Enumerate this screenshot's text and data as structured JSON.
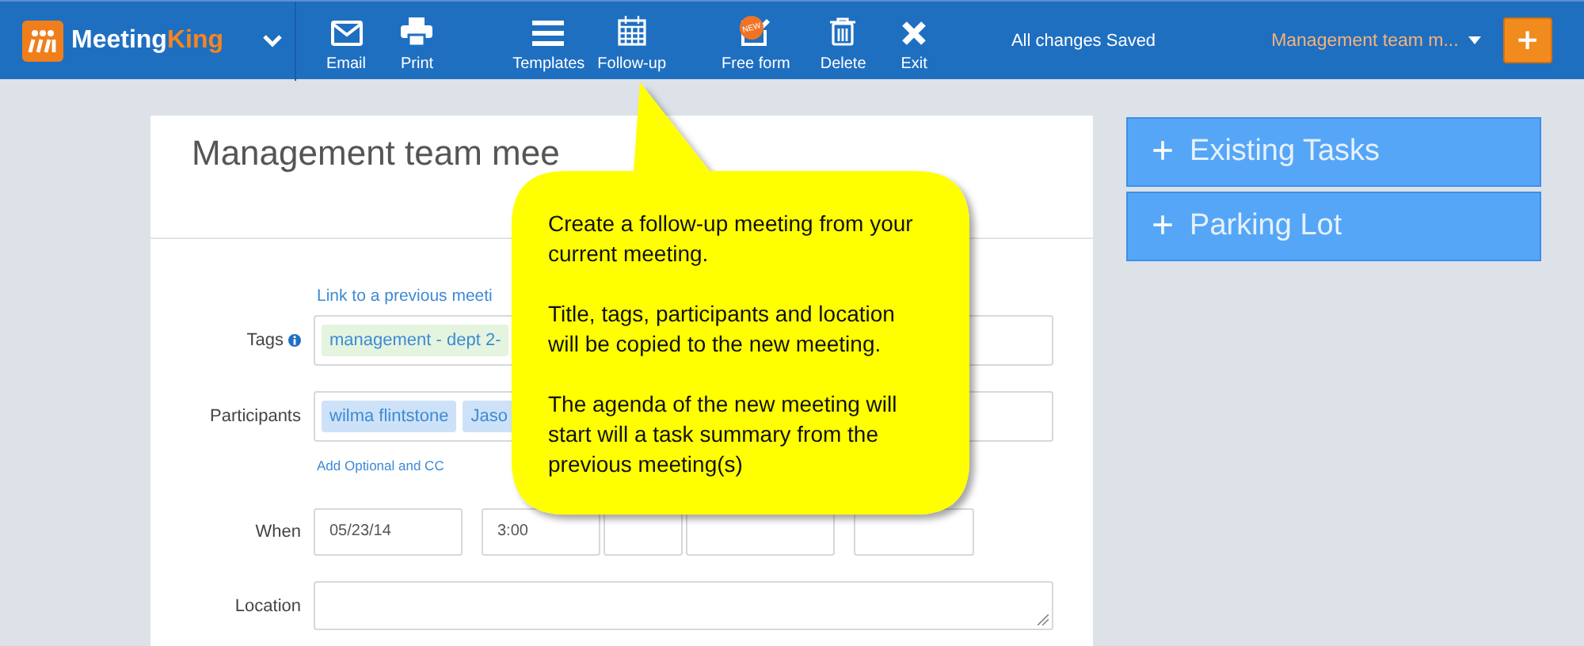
{
  "app": {
    "name_part1": "Meeting",
    "name_part2": "King"
  },
  "toolbar": [
    {
      "label": "Email"
    },
    {
      "label": "Print"
    },
    {
      "label": "Templates"
    },
    {
      "label": "Follow-up"
    },
    {
      "label": "Free form",
      "badge": "NEW"
    },
    {
      "label": "Delete"
    },
    {
      "label": "Exit"
    }
  ],
  "status": "All changes Saved",
  "meeting_select": "Management team m...",
  "add_button": "+",
  "form": {
    "title": "Management team mee",
    "link": "Link to a previous meeti",
    "tags": {
      "label": "Tags",
      "chips": [
        "management - dept 2-"
      ]
    },
    "participants": {
      "label": "Participants",
      "chips": [
        "wilma flintstone",
        "Jaso"
      ]
    },
    "add_link": "Add Optional and CC",
    "when": {
      "label": "When",
      "fields": [
        {
          "kind": "date",
          "value": "05/23/14"
        },
        {
          "kind": "time",
          "value": "3:00"
        },
        {
          "kind": "input"
        },
        {
          "kind": "input"
        },
        {
          "kind": "input"
        }
      ]
    },
    "location": {
      "label": "Location"
    }
  },
  "panels": [
    {
      "icon": "+",
      "label": "Existing Tasks"
    },
    {
      "icon": "+",
      "label": "Parking Lot"
    }
  ],
  "callout": {
    "paragraphs": [
      "Create a follow-up meeting from your current meeting.",
      "Title, tags, participants and location will be copied to the new meeting.",
      "The agenda of the new meeting will start will a task summary from the previous meeting(s)"
    ]
  }
}
